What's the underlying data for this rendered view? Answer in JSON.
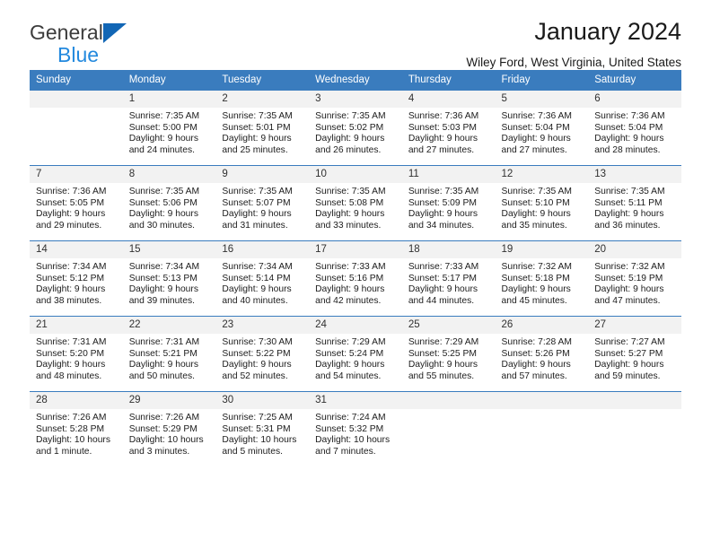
{
  "brand": {
    "word1": "General",
    "word2": "Blue",
    "triangle_icon": "triangle-logo-icon",
    "accent_dark": "#1266b5",
    "accent_light": "#2389de"
  },
  "header": {
    "month_title": "January 2024",
    "location": "Wiley Ford, West Virginia, United States"
  },
  "colors": {
    "header_row_bg": "#3a7cbe",
    "daynum_bg": "#f2f2f2",
    "grid_line": "#3a7cbe",
    "text": "#1c1c1c"
  },
  "weekdays": [
    "Sunday",
    "Monday",
    "Tuesday",
    "Wednesday",
    "Thursday",
    "Friday",
    "Saturday"
  ],
  "weeks": [
    [
      {
        "day": "",
        "blank": true
      },
      {
        "day": "1",
        "sunrise": "Sunrise: 7:35 AM",
        "sunset": "Sunset: 5:00 PM",
        "daylight1": "Daylight: 9 hours",
        "daylight2": "and 24 minutes."
      },
      {
        "day": "2",
        "sunrise": "Sunrise: 7:35 AM",
        "sunset": "Sunset: 5:01 PM",
        "daylight1": "Daylight: 9 hours",
        "daylight2": "and 25 minutes."
      },
      {
        "day": "3",
        "sunrise": "Sunrise: 7:35 AM",
        "sunset": "Sunset: 5:02 PM",
        "daylight1": "Daylight: 9 hours",
        "daylight2": "and 26 minutes."
      },
      {
        "day": "4",
        "sunrise": "Sunrise: 7:36 AM",
        "sunset": "Sunset: 5:03 PM",
        "daylight1": "Daylight: 9 hours",
        "daylight2": "and 27 minutes."
      },
      {
        "day": "5",
        "sunrise": "Sunrise: 7:36 AM",
        "sunset": "Sunset: 5:04 PM",
        "daylight1": "Daylight: 9 hours",
        "daylight2": "and 27 minutes."
      },
      {
        "day": "6",
        "sunrise": "Sunrise: 7:36 AM",
        "sunset": "Sunset: 5:04 PM",
        "daylight1": "Daylight: 9 hours",
        "daylight2": "and 28 minutes."
      }
    ],
    [
      {
        "day": "7",
        "sunrise": "Sunrise: 7:36 AM",
        "sunset": "Sunset: 5:05 PM",
        "daylight1": "Daylight: 9 hours",
        "daylight2": "and 29 minutes."
      },
      {
        "day": "8",
        "sunrise": "Sunrise: 7:35 AM",
        "sunset": "Sunset: 5:06 PM",
        "daylight1": "Daylight: 9 hours",
        "daylight2": "and 30 minutes."
      },
      {
        "day": "9",
        "sunrise": "Sunrise: 7:35 AM",
        "sunset": "Sunset: 5:07 PM",
        "daylight1": "Daylight: 9 hours",
        "daylight2": "and 31 minutes."
      },
      {
        "day": "10",
        "sunrise": "Sunrise: 7:35 AM",
        "sunset": "Sunset: 5:08 PM",
        "daylight1": "Daylight: 9 hours",
        "daylight2": "and 33 minutes."
      },
      {
        "day": "11",
        "sunrise": "Sunrise: 7:35 AM",
        "sunset": "Sunset: 5:09 PM",
        "daylight1": "Daylight: 9 hours",
        "daylight2": "and 34 minutes."
      },
      {
        "day": "12",
        "sunrise": "Sunrise: 7:35 AM",
        "sunset": "Sunset: 5:10 PM",
        "daylight1": "Daylight: 9 hours",
        "daylight2": "and 35 minutes."
      },
      {
        "day": "13",
        "sunrise": "Sunrise: 7:35 AM",
        "sunset": "Sunset: 5:11 PM",
        "daylight1": "Daylight: 9 hours",
        "daylight2": "and 36 minutes."
      }
    ],
    [
      {
        "day": "14",
        "sunrise": "Sunrise: 7:34 AM",
        "sunset": "Sunset: 5:12 PM",
        "daylight1": "Daylight: 9 hours",
        "daylight2": "and 38 minutes."
      },
      {
        "day": "15",
        "sunrise": "Sunrise: 7:34 AM",
        "sunset": "Sunset: 5:13 PM",
        "daylight1": "Daylight: 9 hours",
        "daylight2": "and 39 minutes."
      },
      {
        "day": "16",
        "sunrise": "Sunrise: 7:34 AM",
        "sunset": "Sunset: 5:14 PM",
        "daylight1": "Daylight: 9 hours",
        "daylight2": "and 40 minutes."
      },
      {
        "day": "17",
        "sunrise": "Sunrise: 7:33 AM",
        "sunset": "Sunset: 5:16 PM",
        "daylight1": "Daylight: 9 hours",
        "daylight2": "and 42 minutes."
      },
      {
        "day": "18",
        "sunrise": "Sunrise: 7:33 AM",
        "sunset": "Sunset: 5:17 PM",
        "daylight1": "Daylight: 9 hours",
        "daylight2": "and 44 minutes."
      },
      {
        "day": "19",
        "sunrise": "Sunrise: 7:32 AM",
        "sunset": "Sunset: 5:18 PM",
        "daylight1": "Daylight: 9 hours",
        "daylight2": "and 45 minutes."
      },
      {
        "day": "20",
        "sunrise": "Sunrise: 7:32 AM",
        "sunset": "Sunset: 5:19 PM",
        "daylight1": "Daylight: 9 hours",
        "daylight2": "and 47 minutes."
      }
    ],
    [
      {
        "day": "21",
        "sunrise": "Sunrise: 7:31 AM",
        "sunset": "Sunset: 5:20 PM",
        "daylight1": "Daylight: 9 hours",
        "daylight2": "and 48 minutes."
      },
      {
        "day": "22",
        "sunrise": "Sunrise: 7:31 AM",
        "sunset": "Sunset: 5:21 PM",
        "daylight1": "Daylight: 9 hours",
        "daylight2": "and 50 minutes."
      },
      {
        "day": "23",
        "sunrise": "Sunrise: 7:30 AM",
        "sunset": "Sunset: 5:22 PM",
        "daylight1": "Daylight: 9 hours",
        "daylight2": "and 52 minutes."
      },
      {
        "day": "24",
        "sunrise": "Sunrise: 7:29 AM",
        "sunset": "Sunset: 5:24 PM",
        "daylight1": "Daylight: 9 hours",
        "daylight2": "and 54 minutes."
      },
      {
        "day": "25",
        "sunrise": "Sunrise: 7:29 AM",
        "sunset": "Sunset: 5:25 PM",
        "daylight1": "Daylight: 9 hours",
        "daylight2": "and 55 minutes."
      },
      {
        "day": "26",
        "sunrise": "Sunrise: 7:28 AM",
        "sunset": "Sunset: 5:26 PM",
        "daylight1": "Daylight: 9 hours",
        "daylight2": "and 57 minutes."
      },
      {
        "day": "27",
        "sunrise": "Sunrise: 7:27 AM",
        "sunset": "Sunset: 5:27 PM",
        "daylight1": "Daylight: 9 hours",
        "daylight2": "and 59 minutes."
      }
    ],
    [
      {
        "day": "28",
        "sunrise": "Sunrise: 7:26 AM",
        "sunset": "Sunset: 5:28 PM",
        "daylight1": "Daylight: 10 hours",
        "daylight2": "and 1 minute."
      },
      {
        "day": "29",
        "sunrise": "Sunrise: 7:26 AM",
        "sunset": "Sunset: 5:29 PM",
        "daylight1": "Daylight: 10 hours",
        "daylight2": "and 3 minutes."
      },
      {
        "day": "30",
        "sunrise": "Sunrise: 7:25 AM",
        "sunset": "Sunset: 5:31 PM",
        "daylight1": "Daylight: 10 hours",
        "daylight2": "and 5 minutes."
      },
      {
        "day": "31",
        "sunrise": "Sunrise: 7:24 AM",
        "sunset": "Sunset: 5:32 PM",
        "daylight1": "Daylight: 10 hours",
        "daylight2": "and 7 minutes."
      },
      {
        "day": "",
        "blank": true
      },
      {
        "day": "",
        "blank": true
      },
      {
        "day": "",
        "blank": true
      }
    ]
  ]
}
